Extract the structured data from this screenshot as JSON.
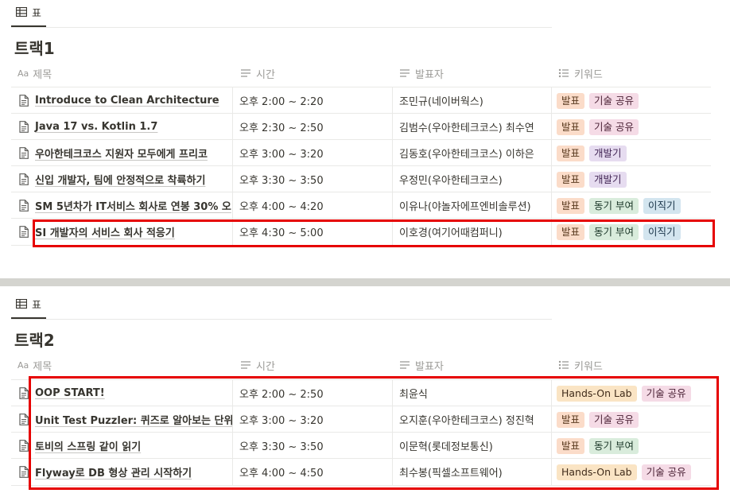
{
  "colors": {
    "tag_orange": "#fbdcc9",
    "tag_pink": "#f5dbe6",
    "tag_purple": "#e6dcf0",
    "tag_green": "#d9ecdc",
    "tag_blue": "#d3e5ef",
    "tag_yellow": "#fae4c4",
    "highlight": "#e60000"
  },
  "section1": {
    "tab_label": "표",
    "title": "트랙1",
    "columns": [
      "제목",
      "시간",
      "발표자",
      "키워드"
    ],
    "rows": [
      {
        "title": "Introduce to Clean Architecture",
        "time": "오후 2:00 ~ 2:20",
        "speaker": "조민규(네이버웍스)",
        "tags": [
          {
            "label": "발표",
            "color": "orange"
          },
          {
            "label": "기술 공유",
            "color": "pink"
          }
        ]
      },
      {
        "title": "Java 17 vs. Kotlin 1.7",
        "time": "오후 2:30 ~ 2:50",
        "speaker": "김범수(우아한테크코스) 최수연",
        "tags": [
          {
            "label": "발표",
            "color": "orange"
          },
          {
            "label": "기술 공유",
            "color": "pink"
          }
        ]
      },
      {
        "title": "우아한테크코스 지원자 모두에게 프리코",
        "time": "오후 3:00 ~ 3:20",
        "speaker": "김동호(우아한테크코스) 이하은",
        "tags": [
          {
            "label": "발표",
            "color": "orange"
          },
          {
            "label": "개발기",
            "color": "purple"
          }
        ]
      },
      {
        "title": "신입 개발자, 팀에 안정적으로 착륙하기",
        "time": "오후 3:30 ~ 3:50",
        "speaker": "우정민(우아한테크코스)",
        "tags": [
          {
            "label": "발표",
            "color": "orange"
          },
          {
            "label": "개발기",
            "color": "purple"
          }
        ]
      },
      {
        "title": "SM 5년차가 IT서비스 회사로 연봉 30% 오",
        "time": "오후 4:00 ~ 4:20",
        "speaker": "이유나(야놀자에프엔비솔루션)",
        "tags": [
          {
            "label": "발표",
            "color": "orange"
          },
          {
            "label": "동기 부여",
            "color": "green"
          },
          {
            "label": "이직기",
            "color": "blue"
          }
        ]
      },
      {
        "title": "SI 개발자의 서비스 회사 적응기",
        "time": "오후 4:30 ~ 5:00",
        "speaker": "이호경(여기어때컴퍼니)",
        "tags": [
          {
            "label": "발표",
            "color": "orange"
          },
          {
            "label": "동기 부여",
            "color": "green"
          },
          {
            "label": "이직기",
            "color": "blue"
          }
        ]
      }
    ]
  },
  "section2": {
    "tab_label": "표",
    "title": "트랙2",
    "columns": [
      "제목",
      "시간",
      "발표자",
      "키워드"
    ],
    "rows": [
      {
        "title": "OOP START!",
        "time": "오후 2:00 ~ 2:50",
        "speaker": "최윤식",
        "tags": [
          {
            "label": "Hands-On Lab",
            "color": "yellow"
          },
          {
            "label": "기술 공유",
            "color": "pink"
          }
        ]
      },
      {
        "title": "Unit Test Puzzler: 퀴즈로 알아보는 단위",
        "time": "오후 3:00 ~ 3:20",
        "speaker": "오지훈(우아한테크코스) 정진혁",
        "tags": [
          {
            "label": "발표",
            "color": "orange"
          },
          {
            "label": "기술 공유",
            "color": "pink"
          }
        ]
      },
      {
        "title": "토비의 스프링 같이 읽기",
        "time": "오후 3:30 ~ 3:50",
        "speaker": "이문혁(롯데정보통신)",
        "tags": [
          {
            "label": "발표",
            "color": "orange"
          },
          {
            "label": "동기 부여",
            "color": "green"
          }
        ]
      },
      {
        "title": "Flyway로 DB 형상 관리 시작하기",
        "time": "오후 4:00 ~ 4:50",
        "speaker": "최수봉(픽셀소프트웨어)",
        "tags": [
          {
            "label": "Hands-On Lab",
            "color": "yellow"
          },
          {
            "label": "기술 공유",
            "color": "pink"
          }
        ]
      }
    ]
  }
}
